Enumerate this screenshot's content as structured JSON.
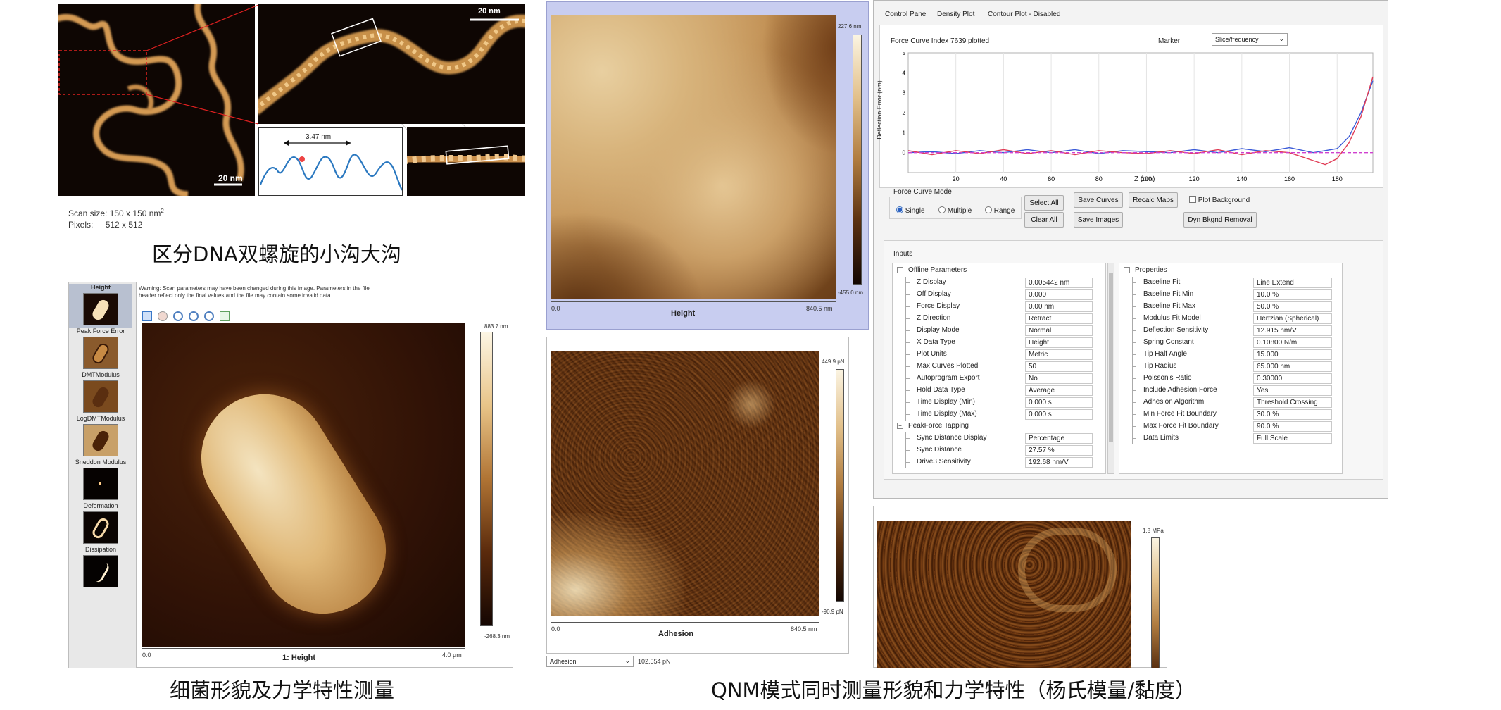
{
  "dna": {
    "scale_bar_main": "20 nm",
    "scale_bar_zoom": "20 nm",
    "profile_label": "3.47 nm",
    "scan_size_label": "Scan size:",
    "scan_size_value": "150 x 150 nm",
    "scan_size_sup": "2",
    "pixels_label": "Pixels:",
    "pixels_value": "512 x 512",
    "caption": "区分DNA双螺旋的小沟大沟"
  },
  "bacteria": {
    "thumbnails": [
      "Height",
      "Peak Force Error",
      "DMTModulus",
      "LogDMTModulus",
      "Sneddon Modulus",
      "Deformation",
      "Dissipation"
    ],
    "warning": "Warning: Scan parameters may have been changed during this image. Parameters in the file header reflect only the final values and the file may contain some invalid data.",
    "cbar_max": "883.7 nm",
    "cbar_min": "-268.3 nm",
    "axis_start": "0.0",
    "axis_end": "4.0 µm",
    "image_title": "1: Height",
    "caption": "细菌形貌及力学特性测量"
  },
  "height_image": {
    "cbar_max": "227.6 nm",
    "cbar_min": "-455.0 nm",
    "axis_start": "0.0",
    "axis_end": "840.5 nm",
    "title": "Height"
  },
  "adhesion_image": {
    "cbar_max": "449.9 pN",
    "cbar_min": "-90.9 pN",
    "axis_start": "0.0",
    "axis_end": "840.5 nm",
    "title": "Adhesion",
    "channel_select": "Adhesion",
    "readout": "102.554 pN"
  },
  "modulus_image": {
    "cbar_max": "1.8 MPa"
  },
  "control_panel": {
    "tabs": [
      "Control Panel",
      "Density Plot",
      "Contour Plot - Disabled"
    ],
    "curve_index": "Force Curve Index 7639 plotted",
    "marker_label": "Marker",
    "marker_value": "Slice/frequency",
    "force_curve_mode_label": "Force Curve Mode",
    "modes": [
      "Single",
      "Multiple",
      "Range"
    ],
    "buttons": {
      "select_all": "Select All",
      "clear_all": "Clear All",
      "save_curves": "Save Curves",
      "save_images": "Save Images",
      "recalc_maps": "Recalc Maps",
      "dyn_bkgnd": "Dyn Bkgnd Removal",
      "plot_background": "Plot Background"
    },
    "inputs_label": "Inputs",
    "offline_header": "Offline Parameters",
    "offline_params": [
      {
        "label": "Z Display",
        "value": "0.005442 nm"
      },
      {
        "label": "Off Display",
        "value": "0.000"
      },
      {
        "label": "Force Display",
        "value": "0.00 nm"
      },
      {
        "label": "Z Direction",
        "value": "Retract"
      },
      {
        "label": "Display Mode",
        "value": "Normal"
      },
      {
        "label": "X Data Type",
        "value": "Height"
      },
      {
        "label": "Plot Units",
        "value": "Metric"
      },
      {
        "label": "Max Curves Plotted",
        "value": "50"
      },
      {
        "label": "Autoprogram Export",
        "value": "No"
      },
      {
        "label": "Hold Data Type",
        "value": "Average"
      },
      {
        "label": "Time Display (Min)",
        "value": "0.000 s"
      },
      {
        "label": "Time Display (Max)",
        "value": "0.000 s"
      }
    ],
    "peakforce_header": "PeakForce Tapping",
    "peakforce_params": [
      {
        "label": "Sync Distance Display",
        "value": "Percentage"
      },
      {
        "label": "Sync Distance",
        "value": "27.57 %"
      },
      {
        "label": "Drive3 Sensitivity",
        "value": "192.68 nm/V"
      }
    ],
    "properties_header": "Properties",
    "properties": [
      {
        "label": "Baseline Fit",
        "value": "Line Extend"
      },
      {
        "label": "Baseline Fit Min",
        "value": "10.0 %"
      },
      {
        "label": "Baseline Fit Max",
        "value": "50.0 %"
      },
      {
        "label": "Modulus Fit Model",
        "value": "Hertzian (Spherical)"
      },
      {
        "label": "Deflection Sensitivity",
        "value": "12.915 nm/V"
      },
      {
        "label": "Spring Constant",
        "value": "0.10800 N/m"
      },
      {
        "label": "Tip Half Angle",
        "value": "15.000"
      },
      {
        "label": "Tip Radius",
        "value": "65.000 nm"
      },
      {
        "label": "Poisson's Ratio",
        "value": "0.30000"
      },
      {
        "label": "Include Adhesion Force",
        "value": "Yes"
      },
      {
        "label": "Adhesion Algorithm",
        "value": "Threshold Crossing"
      },
      {
        "label": "Min Force Fit Boundary",
        "value": "30.0 %"
      },
      {
        "label": "Max Force Fit Boundary",
        "value": "90.0 %"
      },
      {
        "label": "Data Limits",
        "value": "Full Scale"
      }
    ]
  },
  "chart_data": {
    "type": "line",
    "title": "",
    "xlabel": "Z (nm)",
    "ylabel": "Deflection Error (nm)",
    "x_ticks": [
      20,
      40,
      60,
      80,
      100,
      120,
      140,
      160,
      180
    ],
    "y_ticks": [
      0,
      1,
      2,
      3,
      4,
      5
    ],
    "xlim": [
      0,
      195
    ],
    "ylim": [
      -1,
      5
    ],
    "series": [
      {
        "color": "#3a5ad8",
        "x": [
          0,
          10,
          20,
          30,
          40,
          50,
          60,
          70,
          80,
          90,
          100,
          110,
          120,
          130,
          140,
          150,
          160,
          170,
          180,
          185,
          190,
          195
        ],
        "y": [
          0.0,
          0.05,
          -0.05,
          0.1,
          0.0,
          0.15,
          0.0,
          0.15,
          -0.05,
          0.1,
          0.05,
          0.0,
          0.15,
          0.0,
          0.2,
          0.05,
          0.25,
          0.0,
          0.2,
          0.8,
          2.0,
          3.6
        ]
      },
      {
        "color": "#e03b55",
        "x": [
          0,
          10,
          20,
          30,
          40,
          50,
          60,
          70,
          80,
          90,
          100,
          110,
          120,
          130,
          140,
          150,
          160,
          170,
          175,
          180,
          185,
          190,
          195
        ],
        "y": [
          0.1,
          -0.1,
          0.1,
          -0.05,
          0.15,
          -0.05,
          0.1,
          -0.1,
          0.1,
          0.0,
          -0.05,
          0.1,
          -0.05,
          0.15,
          -0.1,
          0.1,
          0.0,
          -0.4,
          -0.6,
          -0.3,
          0.5,
          1.8,
          3.8
        ]
      },
      {
        "color": "#d040d0",
        "x": [
          0,
          195
        ],
        "y": [
          0.0,
          0.0
        ]
      }
    ]
  },
  "caption_qnm": "QNM模式同时测量形貌和力学特性（杨氏模量/黏度）"
}
